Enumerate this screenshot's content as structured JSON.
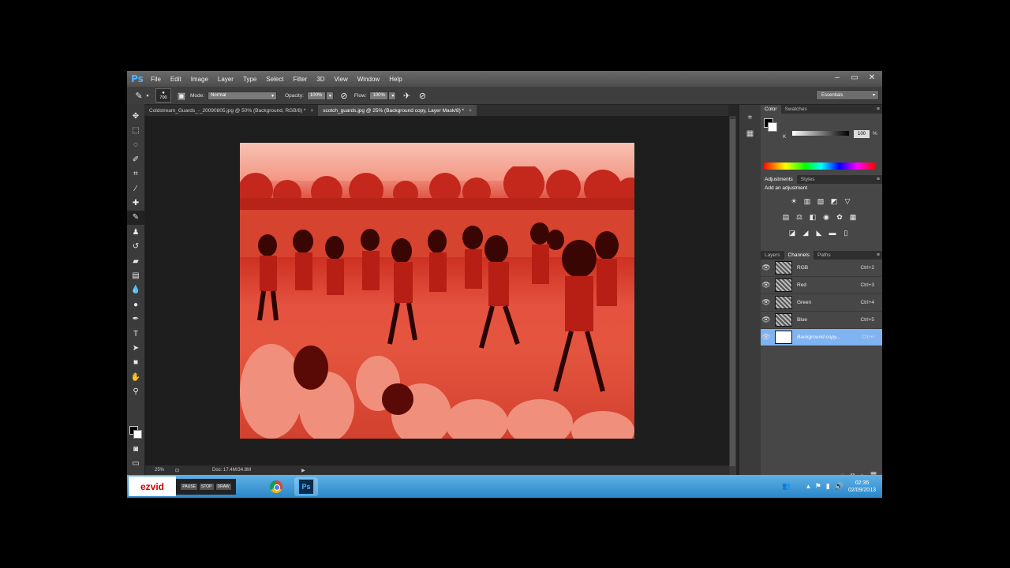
{
  "app": {
    "logo": "Ps"
  },
  "menu": [
    "File",
    "Edit",
    "Image",
    "Layer",
    "Type",
    "Select",
    "Filter",
    "3D",
    "View",
    "Window",
    "Help"
  ],
  "window_controls": [
    "–",
    "▭",
    "✕"
  ],
  "options": {
    "brush_size": "700",
    "mode_label": "Mode:",
    "mode_value": "Normal",
    "opacity_label": "Opacity:",
    "opacity_value": "100%",
    "flow_label": "Flow:",
    "flow_value": "100%",
    "workspace": "Essentials"
  },
  "doc_tabs": [
    {
      "label": "Coldstream_Guards_-_20090805.jpg @ 50% (Background, RGB/8) *",
      "active": false
    },
    {
      "label": "scotch_guards.jpg @ 25% (Background copy, Layer Mask/8) *",
      "active": true
    }
  ],
  "status": {
    "zoom": "25%",
    "doc": "Doc: 17.4M/34.8M"
  },
  "color_panel": {
    "tabs": [
      "Color",
      "Swatches"
    ],
    "channel": "K",
    "value": "100",
    "unit": "%"
  },
  "adjustments_panel": {
    "tabs": [
      "Adjustments",
      "Styles"
    ],
    "title": "Add an adjustment"
  },
  "channels_panel": {
    "tabs": [
      "Layers",
      "Channels",
      "Paths"
    ],
    "rows": [
      {
        "name": "RGB",
        "key": "Ctrl+2",
        "selected": false
      },
      {
        "name": "Red",
        "key": "Ctrl+3",
        "selected": false
      },
      {
        "name": "Green",
        "key": "Ctrl+4",
        "selected": false
      },
      {
        "name": "Blue",
        "key": "Ctrl+5",
        "selected": false
      },
      {
        "name": "Background copy...",
        "key": "Ctrl+\\",
        "selected": true
      }
    ]
  },
  "taskbar": {
    "ezvid_logo": "ezvid",
    "ezvid_controls": [
      "PAUSE",
      "STOP",
      "DRAW"
    ],
    "time": "02:36",
    "date": "02/09/2013"
  }
}
